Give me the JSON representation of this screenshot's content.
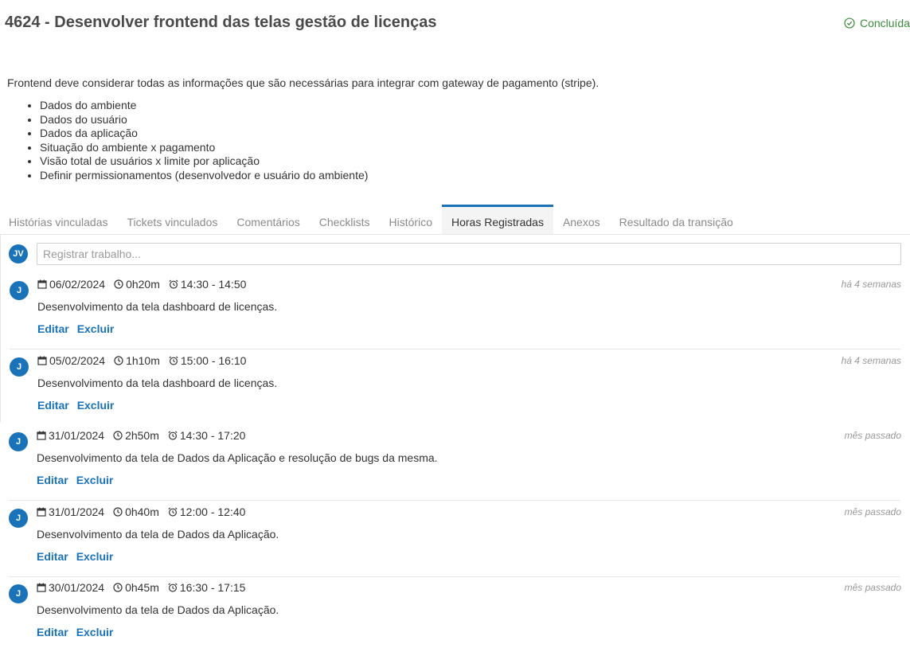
{
  "header": {
    "title": "4624 - Desenvolver frontend das telas gestão de licenças",
    "status": "Concluída",
    "status_color": "#3d8b3d"
  },
  "description": {
    "intro": "Frontend deve considerar todas as informações que são necessárias para integrar com gateway de pagamento (stripe).",
    "items": [
      "Dados do ambiente",
      "Dados do usuário",
      "Dados da aplicação",
      "Situação do ambiente x pagamento",
      "Visão total de usuários x limite por aplicação",
      "Definir permissionamentos (desenvolvedor e usuário do ambiente)"
    ]
  },
  "tabs": [
    {
      "label": "Histórias vinculadas",
      "active": false
    },
    {
      "label": "Tickets vinculados",
      "active": false
    },
    {
      "label": "Comentários",
      "active": false
    },
    {
      "label": "Checklists",
      "active": false
    },
    {
      "label": "Histórico",
      "active": false
    },
    {
      "label": "Horas Registradas",
      "active": true
    },
    {
      "label": "Anexos",
      "active": false
    },
    {
      "label": "Resultado da transição",
      "active": false
    }
  ],
  "register": {
    "avatar": "JV",
    "placeholder": "Registrar trabalho..."
  },
  "entries": [
    {
      "avatar": "J",
      "date": "06/02/2024",
      "duration": "0h20m",
      "range": "14:30 - 14:50",
      "ago": "há 4 semanas",
      "text": "Desenvolvimento da tela dashboard de licenças.",
      "edit": "Editar",
      "delete": "Excluir"
    },
    {
      "avatar": "J",
      "date": "05/02/2024",
      "duration": "1h10m",
      "range": "15:00 - 16:10",
      "ago": "há 4 semanas",
      "text": "Desenvolvimento da tela dashboard de licenças.",
      "edit": "Editar",
      "delete": "Excluir"
    },
    {
      "avatar": "J",
      "date": "31/01/2024",
      "duration": "2h50m",
      "range": "14:30 - 17:20",
      "ago": "mês passado",
      "text": "Desenvolvimento da tela de Dados da Aplicação e resolução de bugs da mesma.",
      "edit": "Editar",
      "delete": "Excluir"
    },
    {
      "avatar": "J",
      "date": "31/01/2024",
      "duration": "0h40m",
      "range": "12:00 - 12:40",
      "ago": "mês passado",
      "text": "Desenvolvimento da tela de Dados da Aplicação.",
      "edit": "Editar",
      "delete": "Excluir"
    },
    {
      "avatar": "J",
      "date": "30/01/2024",
      "duration": "0h45m",
      "range": "16:30 - 17:15",
      "ago": "mês passado",
      "text": "Desenvolvimento da tela de Dados da Aplicação.",
      "edit": "Editar",
      "delete": "Excluir"
    }
  ],
  "icons": {
    "status": "check-circle-icon",
    "date": "calendar-icon",
    "duration": "clock-icon",
    "range": "alarm-clock-icon"
  },
  "colors": {
    "accent": "#1a73b8",
    "muted": "#8a8a8a"
  }
}
